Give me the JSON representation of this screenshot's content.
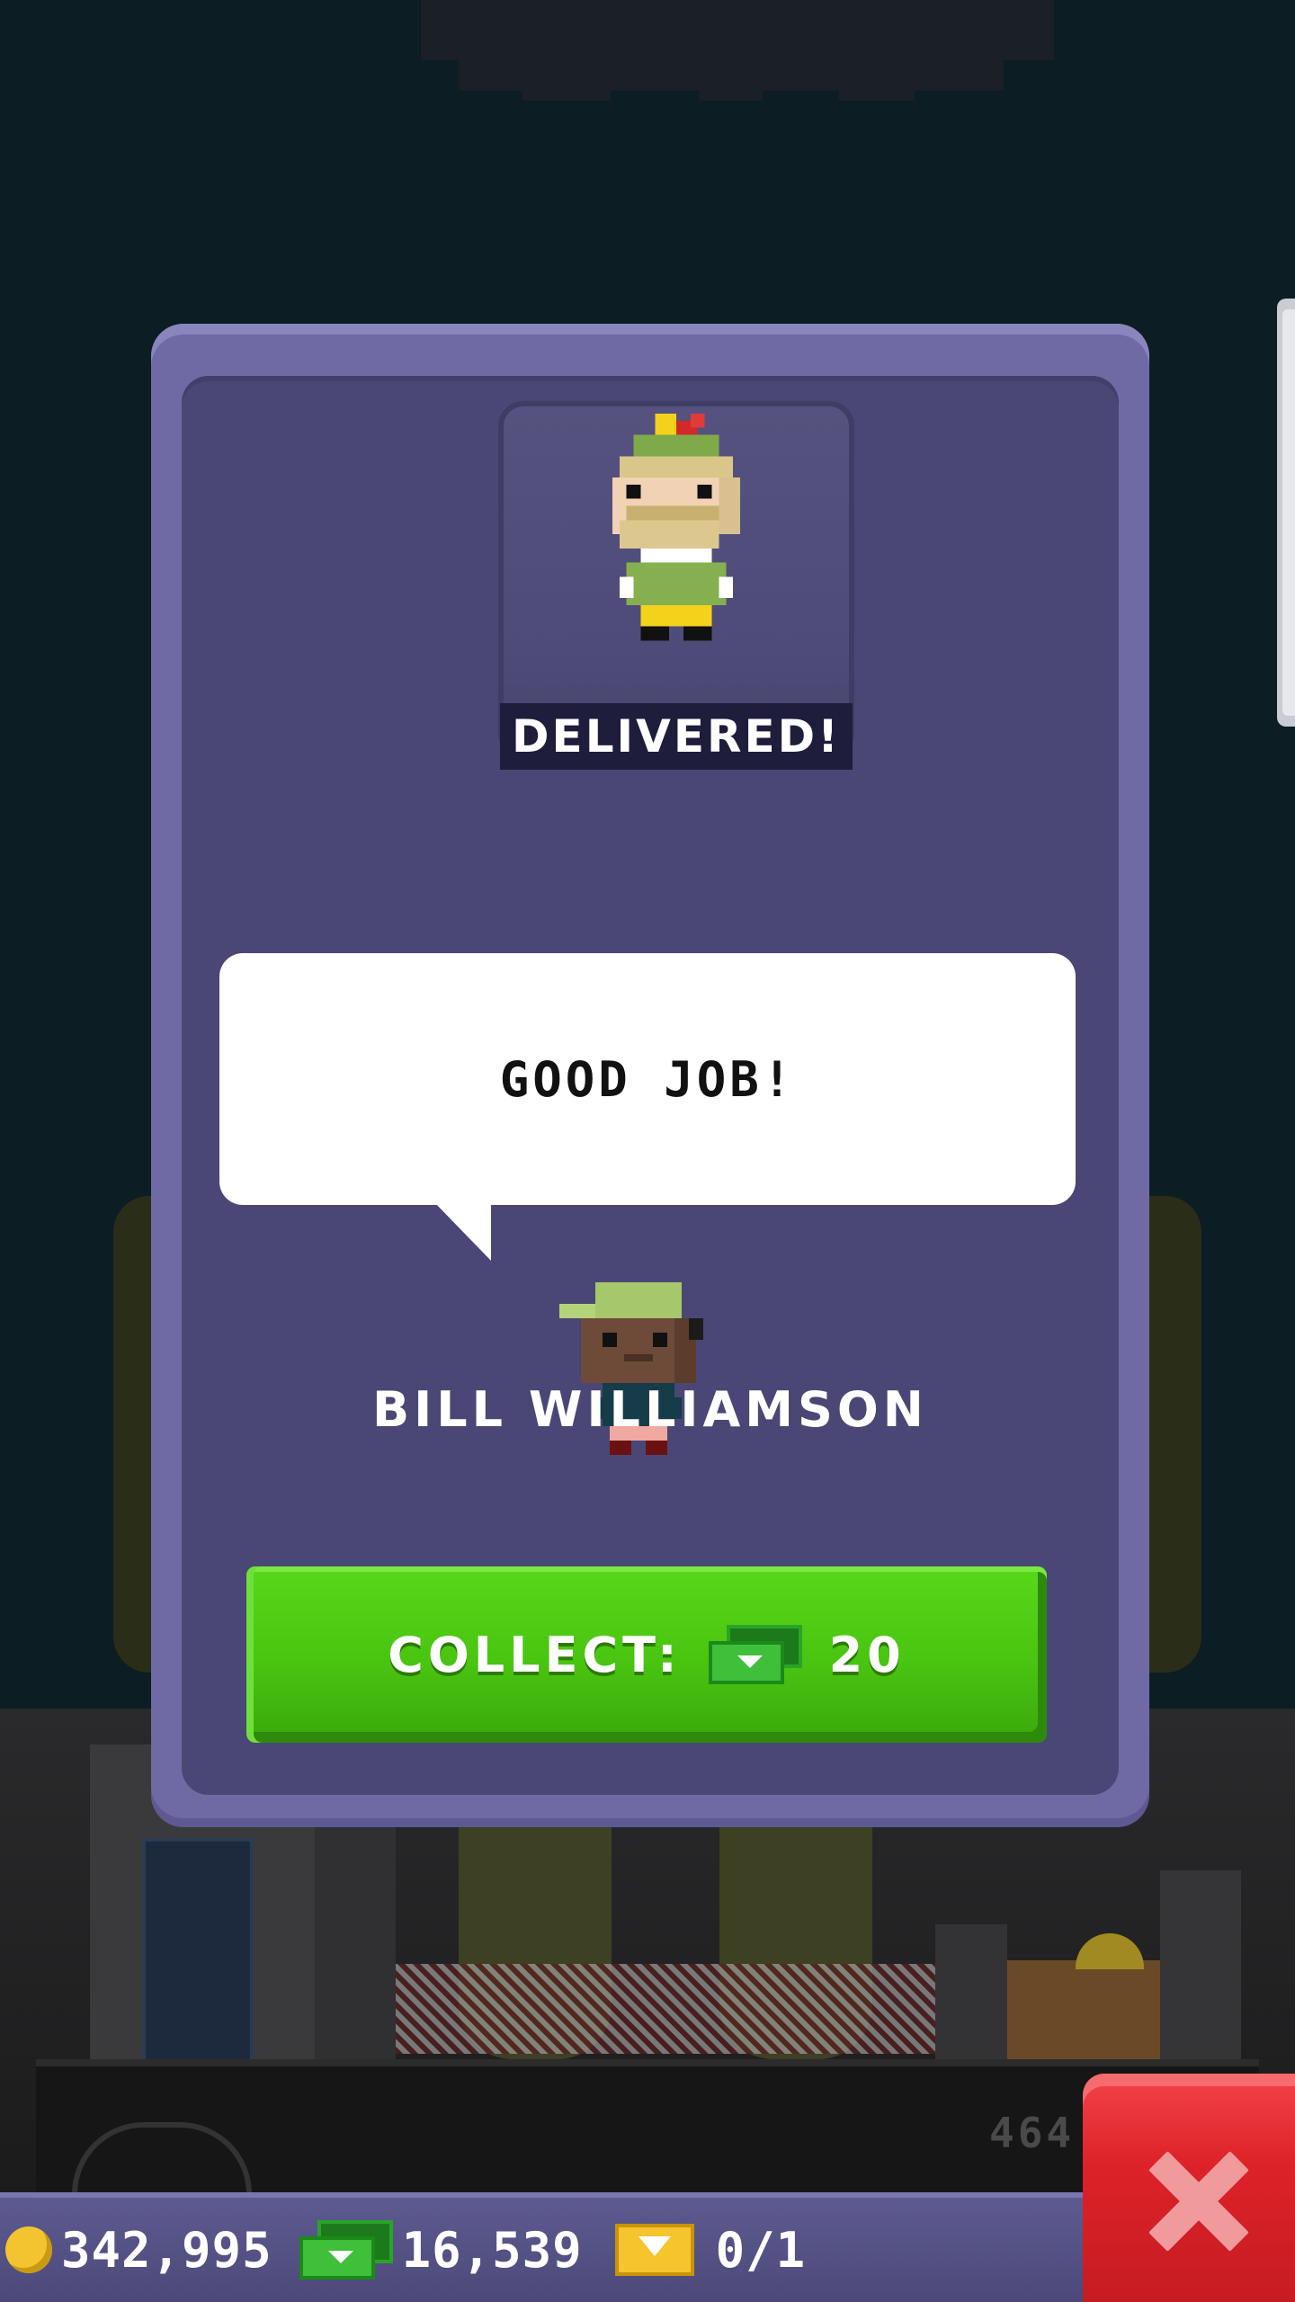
{
  "modal": {
    "status_label": "DELIVERED!",
    "speech": "GOOD JOB!",
    "npc_name": "BILL WILLIAMSON",
    "collect": {
      "label": "COLLECT:",
      "currency_icon": "bux-icon",
      "amount": "20"
    },
    "delivered_character_icon": "elf-character-icon",
    "npc_character_icon": "bellhop-character-icon"
  },
  "currency_bar": {
    "coins": "342,995",
    "bux": "16,539",
    "tickets": "0/1"
  },
  "close_icon": "close-icon",
  "colors": {
    "card": "#6f6aa4",
    "card_inner": "#4a4776",
    "collect_green": "#49c410",
    "close_red": "#dd2228",
    "background": "#0c1d23"
  }
}
